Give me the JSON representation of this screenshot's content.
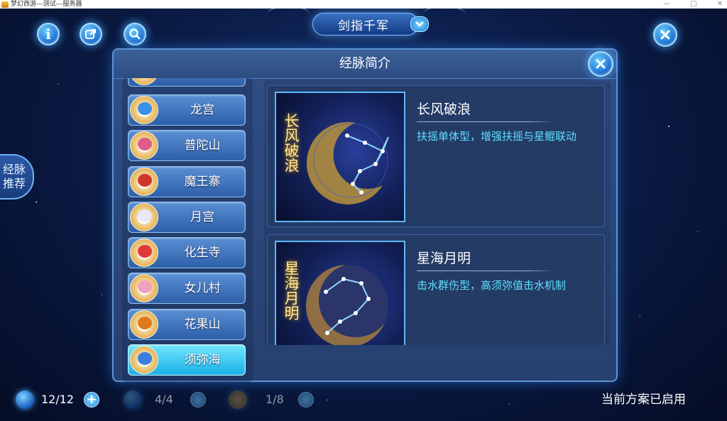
{
  "window": {
    "title": "梦幻西游---测试---服务器",
    "controls": [
      "—",
      "□",
      "✕"
    ]
  },
  "top_buttons": [
    {
      "icon": "info-icon",
      "glyph": "i"
    },
    {
      "icon": "share-icon"
    },
    {
      "icon": "search-icon"
    }
  ],
  "header": {
    "title": "剑指千军",
    "dropdown_icon": "chevron-down-icon"
  },
  "side_tab": {
    "line1": "经脉",
    "line2": "推荐"
  },
  "panel": {
    "title": "经脉简介",
    "close_icon": "close-icon"
  },
  "sects": [
    {
      "label": "",
      "emblem_color": "#2d7fe0",
      "partial": true
    },
    {
      "label": "龙宫",
      "emblem_color": "#3a8fe8"
    },
    {
      "label": "普陀山",
      "emblem_color": "#e05a8a"
    },
    {
      "label": "魔王寨",
      "emblem_color": "#d0352a"
    },
    {
      "label": "月宫",
      "emblem_color": "#e8e8f8"
    },
    {
      "label": "化生寺",
      "emblem_color": "#e03a3a"
    },
    {
      "label": "女儿村",
      "emblem_color": "#f0a0c0"
    },
    {
      "label": "花果山",
      "emblem_color": "#e07a1a"
    },
    {
      "label": "须弥海",
      "emblem_color": "#3a7fe0",
      "active": true
    }
  ],
  "schemes": [
    {
      "name": "长风破浪",
      "image_text": "长风破浪",
      "description": "扶摇单体型，增强扶摇与星鲲联动"
    },
    {
      "name": "星海月明",
      "image_text": "星海月明",
      "description": "击水群伤型，高须弥值击水机制"
    }
  ],
  "bottom": {
    "counter1": "12/12",
    "counter2": "4/4",
    "counter3": "1/8",
    "status": "当前方案已启用",
    "plus_glyph": "+"
  },
  "colors": {
    "accent": "#5fe0ff",
    "panel": "#2d4a7e",
    "active_item": "#1ab0e6"
  }
}
